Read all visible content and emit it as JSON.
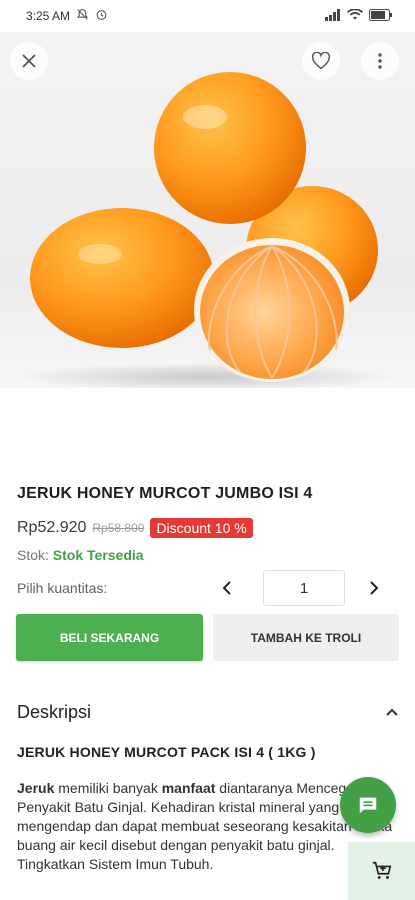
{
  "status_bar": {
    "time": "3:25 AM"
  },
  "product": {
    "title": "JERUK HONEY MURCOT JUMBO ISI 4",
    "price": "Rp52.920",
    "old_price": "Rp58.800",
    "discount": "Discount 10 %",
    "stock_label": "Stok:",
    "stock_value": "Stok Tersedia",
    "qty_label": "Pilih kuantitas:",
    "qty_value": "1"
  },
  "actions": {
    "buy_label": "BELI SEKARANG",
    "cart_label": "TAMBAH KE TROLI"
  },
  "description": {
    "heading": "Deskripsi",
    "subtitle": "JERUK HONEY MURCOT PACK ISI 4  ( 1KG )",
    "bold_1": "Jeruk",
    "text_1": " memiliki banyak ",
    "bold_2": "manfaat",
    "text_2": " diantaranya Mencegah Penyakit Batu Ginjal. Kehadiran kristal mineral yang mengendap dan dapat membuat seseorang kesakitan ketika buang air kecil disebut dengan penyakit batu ginjal. Tingkatkan Sistem Imun Tubuh."
  },
  "colors": {
    "primary_green": "#4caf50",
    "discount_red": "#e53935",
    "stock_green": "#43a047"
  },
  "icons": [
    "close-icon",
    "heart-icon",
    "more-vert-icon",
    "chevron-left-icon",
    "chevron-right-icon",
    "chevron-up-icon",
    "chat-icon",
    "cart-add-icon",
    "wifi-icon",
    "signal-icon",
    "battery-icon",
    "alarm-icon",
    "dnd-icon"
  ]
}
